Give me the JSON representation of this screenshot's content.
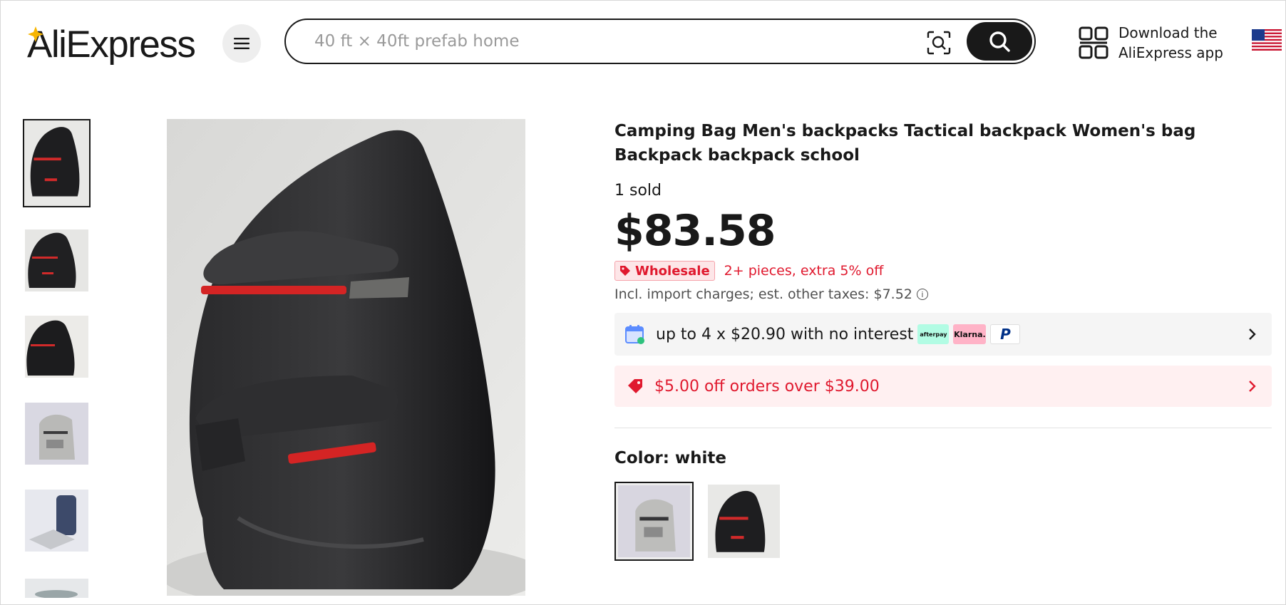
{
  "header": {
    "logo_text": "AliExpress",
    "search_placeholder": "40 ft × 40ft prefab home",
    "app_download_line1": "Download the",
    "app_download_line2": "AliExpress app"
  },
  "product": {
    "title": "Camping Bag Men's backpacks Tactical backpack Women's bag Backpack backpack school",
    "sold": "1 sold",
    "price": "$83.58",
    "wholesale_badge": "Wholesale",
    "wholesale_text": "2+ pieces, extra 5% off",
    "tax_text": "Incl. import charges; est. other taxes: $7.52",
    "tax_info_glyph": "i",
    "installment_text": "up to 4 x $20.90 with no interest",
    "payment_logos": [
      "afterpay",
      "Klarna.",
      "P"
    ],
    "coupon_text": "$5.00 off orders over $39.00",
    "color_label": "Color: white"
  },
  "icons": [
    "menu-icon",
    "image-search-icon",
    "search-icon",
    "qr-code-icon",
    "us-flag-icon",
    "wholesale-tag-icon",
    "calendar-icon",
    "chevron-right-icon",
    "coupon-tag-icon"
  ],
  "colors": {
    "brand_red": "#e0192e",
    "dark": "#191919"
  }
}
